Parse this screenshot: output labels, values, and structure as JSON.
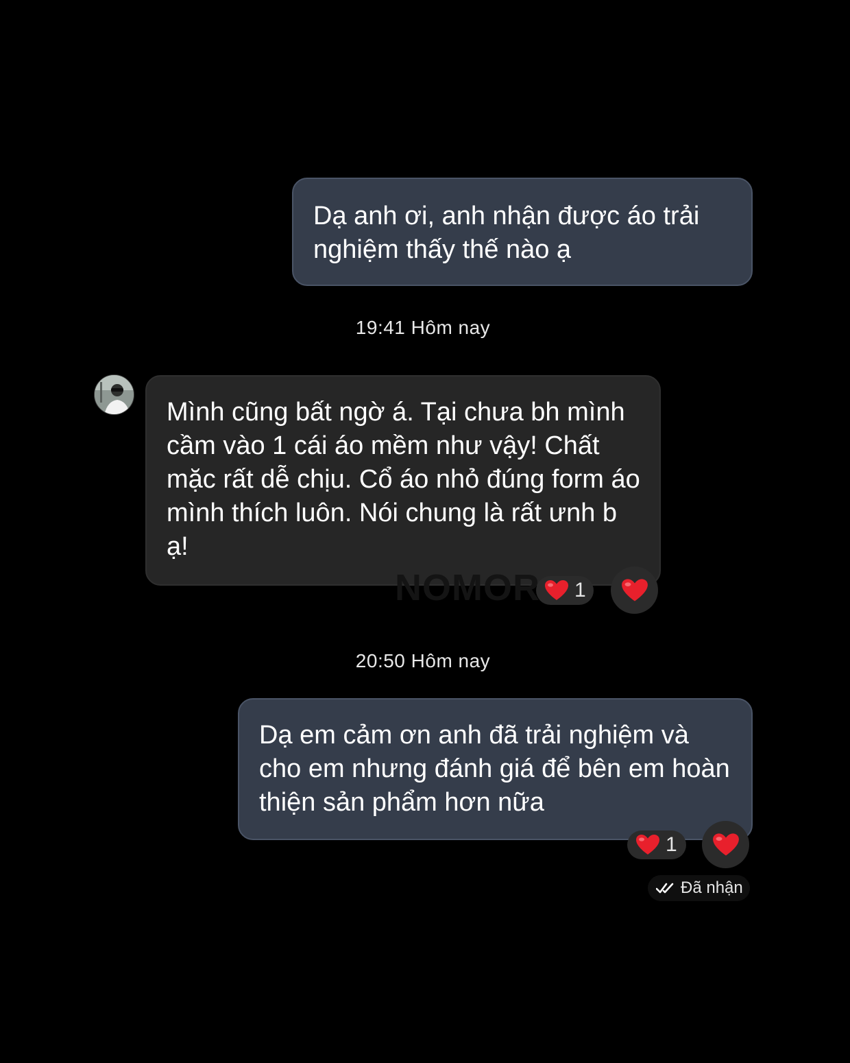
{
  "messages": [
    {
      "direction": "outgoing",
      "text": "Dạ anh ơi, anh nhận được áo trải nghiệm thấy thế nào ạ"
    },
    {
      "direction": "incoming",
      "text": "Mình cũng bất ngờ á. Tại chưa bh mình cầm vào 1 cái áo mềm như vậy! Chất mặc rất dễ chịu. Cổ áo nhỏ đúng form áo mình thích luôn. Nói chung là rất ưnh b ạ!"
    },
    {
      "direction": "outgoing",
      "text": "Dạ em cảm ơn anh đã trải nghiệm và cho em nhưng đánh giá để bên em hoàn thiện sản phẩm hơn nữa"
    }
  ],
  "timestamps": [
    "19:41 Hôm nay",
    "20:50 Hôm nay"
  ],
  "reactions": [
    {
      "icon": "heart-icon",
      "count": "1"
    },
    {
      "icon": "heart-icon",
      "count": "1"
    }
  ],
  "watermark": "NOMOR",
  "status": {
    "icon": "double-check-icon",
    "label": "Đã nhận"
  },
  "colors": {
    "background": "#000000",
    "outgoing_bubble": "#353d4b",
    "incoming_bubble": "#262626",
    "heart": "#e8202c"
  }
}
